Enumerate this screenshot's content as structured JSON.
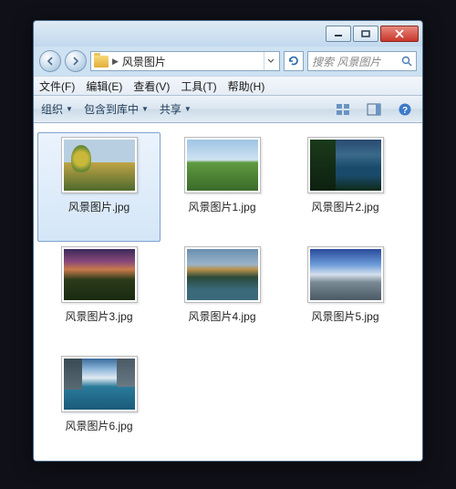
{
  "titlebar": {
    "minimize": "min",
    "maximize": "max",
    "close": "close"
  },
  "nav": {
    "crumb": "风景图片",
    "refresh_glyph": "↻"
  },
  "search": {
    "placeholder": "搜索 风景图片"
  },
  "menu": {
    "file": "文件(F)",
    "edit": "编辑(E)",
    "view": "查看(V)",
    "tools": "工具(T)",
    "help": "帮助(H)"
  },
  "toolbar": {
    "organize": "组织",
    "include": "包含到库中",
    "share": "共享"
  },
  "items": [
    {
      "label": "风景图片.jpg",
      "thumb": "t0",
      "selected": true
    },
    {
      "label": "风景图片1.jpg",
      "thumb": "t1",
      "selected": false
    },
    {
      "label": "风景图片2.jpg",
      "thumb": "t2",
      "selected": false
    },
    {
      "label": "风景图片3.jpg",
      "thumb": "t3",
      "selected": false
    },
    {
      "label": "风景图片4.jpg",
      "thumb": "t4",
      "selected": false
    },
    {
      "label": "风景图片5.jpg",
      "thumb": "t5",
      "selected": false
    },
    {
      "label": "风景图片6.jpg",
      "thumb": "t6",
      "selected": false
    }
  ]
}
